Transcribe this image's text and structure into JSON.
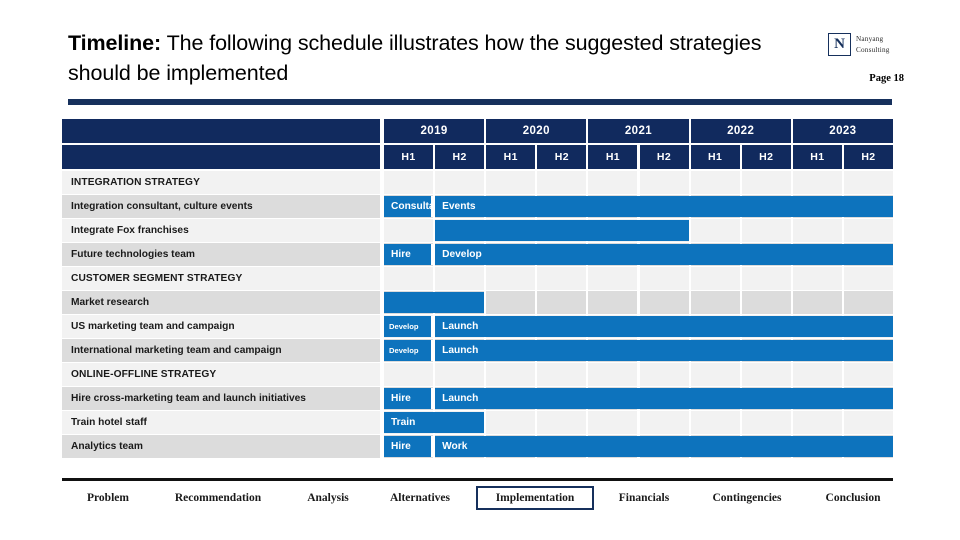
{
  "header": {
    "title_lead": "Timeline:",
    "title_rest": " The following schedule illustrates how the suggested strategies should be implemented",
    "logo": {
      "letter": "N",
      "line1": "Nanyang",
      "line2": "Consulting"
    },
    "page_number": "Page 18"
  },
  "table": {
    "years": [
      "2019",
      "2020",
      "2021",
      "2022",
      "2023"
    ],
    "halves": [
      "H1",
      "H2",
      "H1",
      "H2",
      "H1",
      "H2",
      "H1",
      "H2",
      "H1",
      "H2"
    ],
    "rows": [
      {
        "label": "INTEGRATION STRATEGY",
        "type": "section",
        "band": "light",
        "bars": []
      },
      {
        "label": "Integration consultant, culture events",
        "type": "task",
        "band": "dark",
        "bars": [
          {
            "label": "Consultant",
            "start": 0,
            "span": 1,
            "size": "normal"
          },
          {
            "label": "Events",
            "start": 1,
            "span": 9,
            "size": "normal",
            "last": true
          }
        ]
      },
      {
        "label": "Integrate Fox franchises",
        "type": "task",
        "band": "light",
        "bars": [
          {
            "label": "",
            "start": 1,
            "span": 5,
            "size": "normal",
            "last": true
          }
        ]
      },
      {
        "label": "Future technologies team",
        "type": "task",
        "band": "dark",
        "bars": [
          {
            "label": "Hire",
            "start": 0,
            "span": 1,
            "size": "normal"
          },
          {
            "label": "Develop",
            "start": 1,
            "span": 9,
            "size": "normal",
            "last": true
          }
        ]
      },
      {
        "label": "CUSTOMER SEGMENT STRATEGY",
        "type": "section",
        "band": "light",
        "bars": []
      },
      {
        "label": "Market research",
        "type": "task",
        "band": "dark",
        "bars": [
          {
            "label": "",
            "start": 0,
            "span": 2,
            "size": "normal",
            "last": true
          }
        ]
      },
      {
        "label": "US marketing team and campaign",
        "type": "task",
        "band": "light",
        "bars": [
          {
            "label": "Develop",
            "start": 0,
            "span": 1,
            "size": "small"
          },
          {
            "label": "Launch",
            "start": 1,
            "span": 9,
            "size": "normal",
            "last": true
          }
        ]
      },
      {
        "label": "International marketing team and campaign",
        "type": "task",
        "band": "dark",
        "bars": [
          {
            "label": "Develop",
            "start": 0,
            "span": 1,
            "size": "small"
          },
          {
            "label": "Launch",
            "start": 1,
            "span": 9,
            "size": "normal",
            "last": true
          }
        ]
      },
      {
        "label": "ONLINE-OFFLINE STRATEGY",
        "type": "section",
        "band": "light",
        "bars": []
      },
      {
        "label": "Hire cross-marketing team and launch initiatives",
        "type": "task",
        "band": "dark",
        "bars": [
          {
            "label": "Hire",
            "start": 0,
            "span": 1,
            "size": "normal"
          },
          {
            "label": "Launch",
            "start": 1,
            "span": 9,
            "size": "normal",
            "last": true
          }
        ]
      },
      {
        "label": "Train hotel staff",
        "type": "task",
        "band": "light",
        "bars": [
          {
            "label": "Train",
            "start": 0,
            "span": 2,
            "size": "normal",
            "last": true
          }
        ]
      },
      {
        "label": "Analytics team",
        "type": "task",
        "band": "dark",
        "bars": [
          {
            "label": "Hire",
            "start": 0,
            "span": 1,
            "size": "normal"
          },
          {
            "label": "Work",
            "start": 1,
            "span": 9,
            "size": "normal",
            "last": true
          }
        ]
      }
    ]
  },
  "footer": {
    "items": [
      {
        "label": "Problem",
        "active": false
      },
      {
        "label": "Recommendation",
        "active": false
      },
      {
        "label": "Analysis",
        "active": false
      },
      {
        "label": "Alternatives",
        "active": false
      },
      {
        "label": "Implementation",
        "active": true
      },
      {
        "label": "Financials",
        "active": false
      },
      {
        "label": "Contingencies",
        "active": false
      },
      {
        "label": "Conclusion",
        "active": false
      }
    ]
  },
  "colors": {
    "navy": "#112a5e",
    "bar_blue": "#0d73bd",
    "band_light": "#f2f2f2",
    "band_dark": "#dcdcdc"
  }
}
